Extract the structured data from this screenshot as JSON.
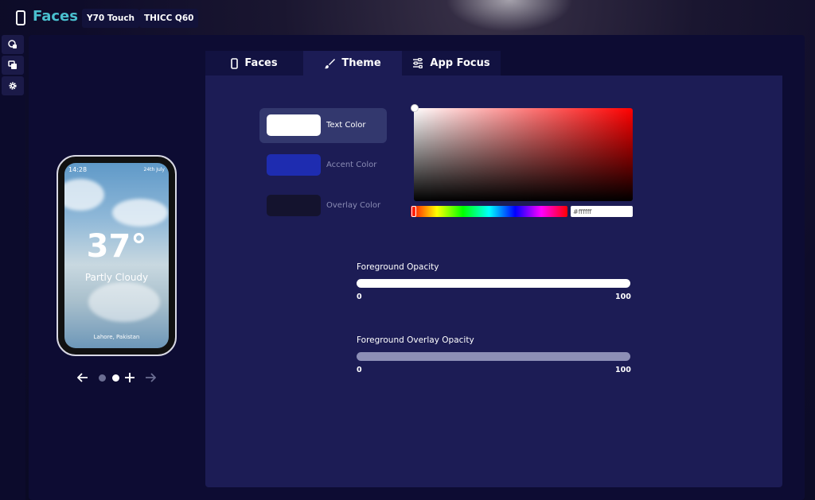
{
  "app": {
    "title": "Faces"
  },
  "devices": [
    "Y70 Touch",
    "THICC Q60"
  ],
  "tabs": [
    {
      "label": "Faces",
      "icon": "phone-icon"
    },
    {
      "label": "Theme",
      "icon": "brush-icon"
    },
    {
      "label": "App Focus",
      "icon": "sliders-icon"
    }
  ],
  "active_tab": "Theme",
  "preview": {
    "time": "14:28",
    "date": "24th July",
    "temperature": "37°",
    "condition": "Partly Cloudy",
    "location": "Lahore, Pakistan"
  },
  "theme": {
    "color_options": [
      {
        "label": "Text Color",
        "color": "#ffffff"
      },
      {
        "label": "Accent Color",
        "color": "#1e2cb0"
      },
      {
        "label": "Overlay Color",
        "color": "#14132e"
      }
    ],
    "hex_value": "#ffffff",
    "sliders": [
      {
        "label": "Foreground Opacity",
        "min": "0",
        "max": "100",
        "value": 100
      },
      {
        "label": "Foreground Overlay Opacity",
        "min": "0",
        "max": "100",
        "value": 100
      }
    ]
  },
  "colors": {
    "accent": "#4ac0cf",
    "panel": "#1c1c55",
    "background": "#0d0c33"
  }
}
